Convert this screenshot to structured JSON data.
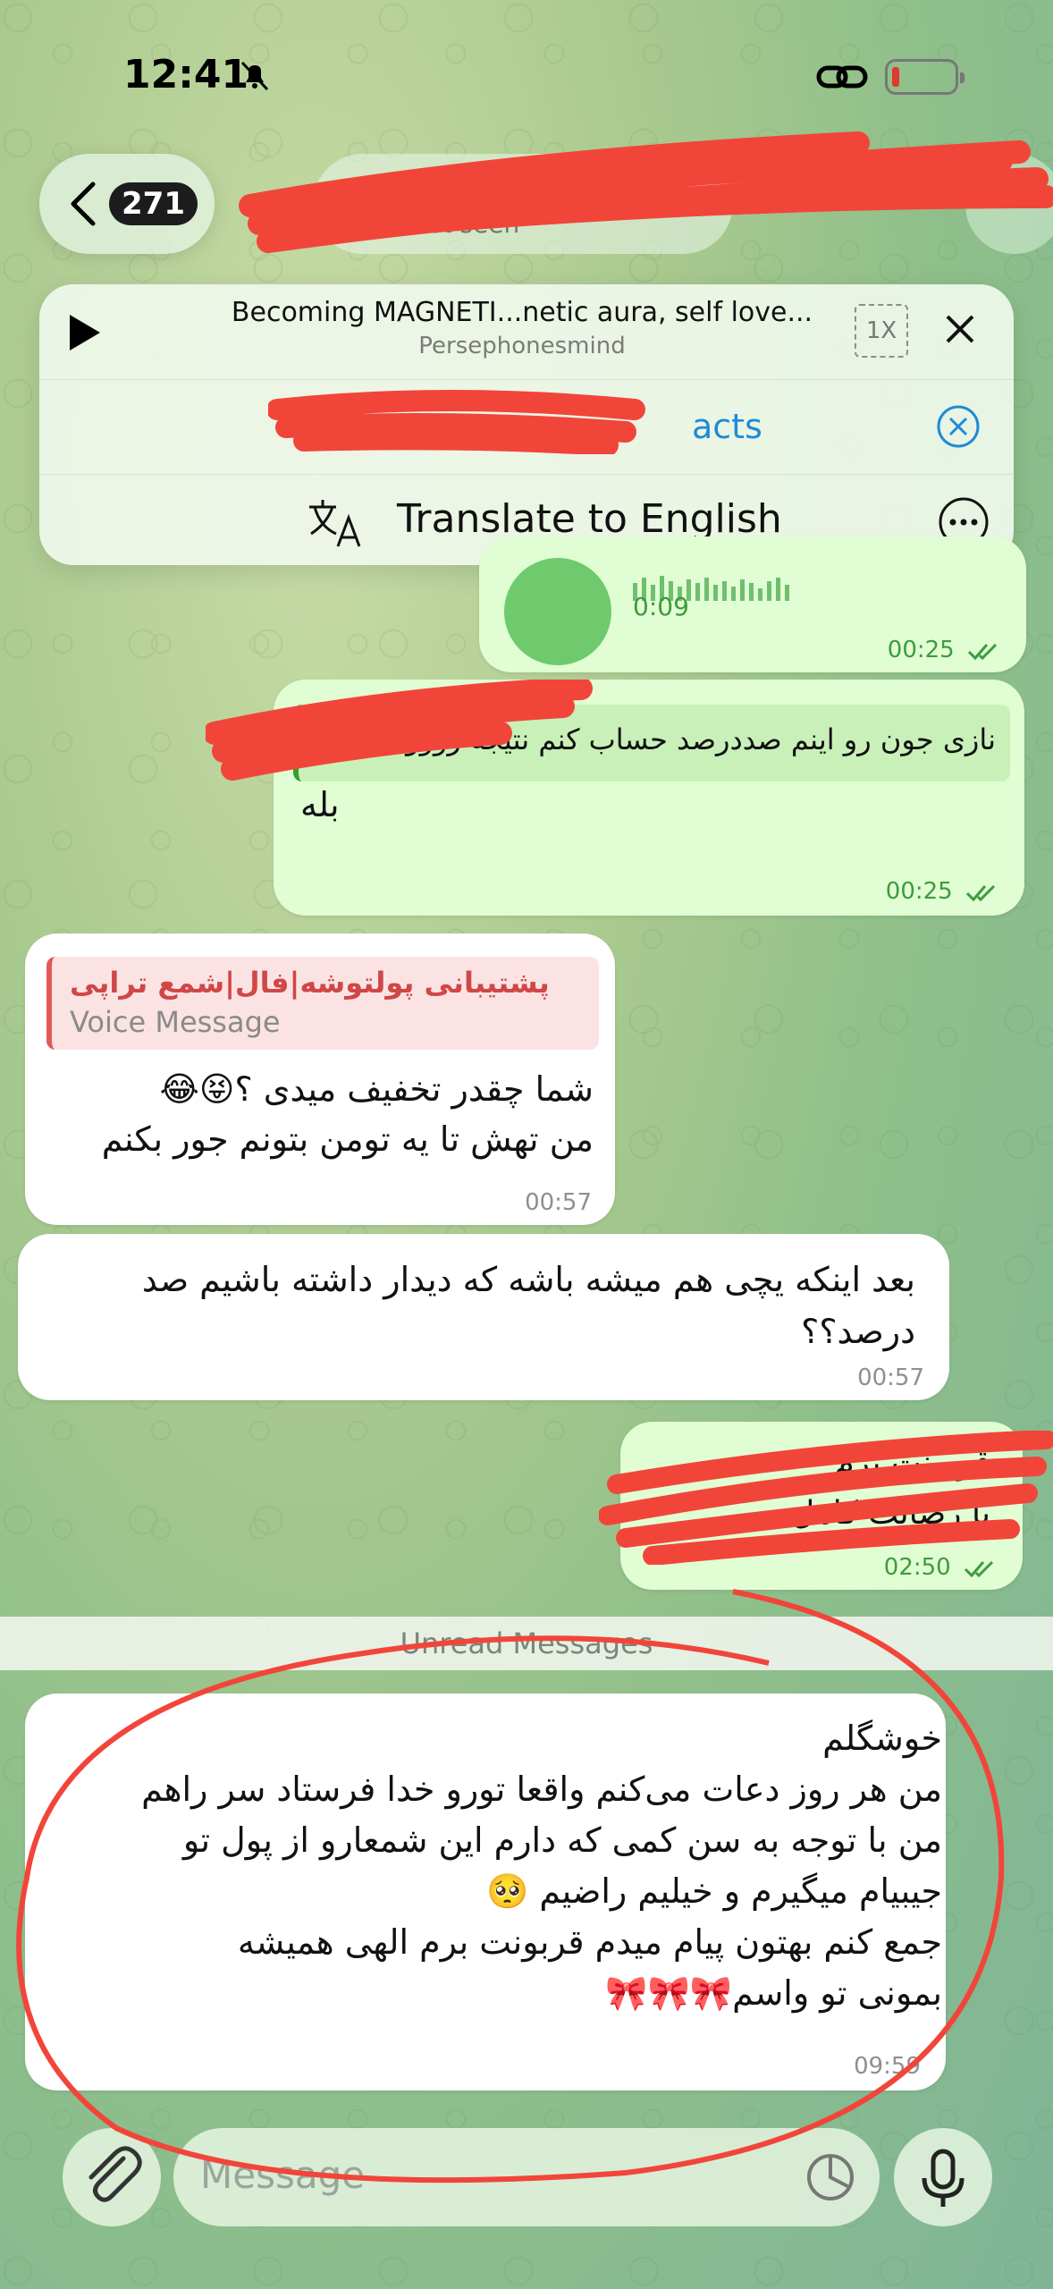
{
  "status_bar": {
    "time": "12:41"
  },
  "header": {
    "back_count": "271",
    "subtitle": "last seen"
  },
  "player": {
    "title": "Becoming MAGNETI...netic aura, self love...",
    "artist": "Persephonesmind",
    "speed": "1X"
  },
  "pinned": {
    "text": "acts"
  },
  "translate": {
    "label": "Translate to English"
  },
  "messages": {
    "voice": {
      "duration": "0:09",
      "time": "00:25"
    },
    "reply": {
      "quote": "نازی جون رو اینم صددرصد حساب کنم نتیجه رووو؟",
      "body": "بله",
      "time": "00:25"
    },
    "in1": {
      "quote_name": "پشتیبانی پولتوشه|فال|شمع تراپی",
      "quote_sub": "Voice Message",
      "lines": [
        "شما چقدر تخفیف میدی ؟😝😂",
        "من تهش تا یه تومن بتونم جور بکنم"
      ],
      "time": "00:57"
    },
    "in2": {
      "text": "بعد اینکه یچی هم میشه باشه که دیدار داشته باشیم صد درصد؟؟",
      "time": "00:57"
    },
    "out3": {
      "line1": "قربونت برم",
      "line2": "با رضایت کامل",
      "time": "02:50"
    },
    "unread_label": "Unread Messages",
    "in4": {
      "lines": [
        "خوشگلم",
        "من هر روز دعات می‌کنم واقعا تورو خدا فرستاد سر راهم",
        "من با توجه به سن کمی که دارم این شمعارو از پول تو",
        "جیبیام میگیرم و خیلیم راضیم 🥺",
        "جمع کنم بهتون پیام میدم قربونت برم الهی همیشه",
        "بمونی تو واسم🎀🎀🎀"
      ],
      "time": "09:59"
    }
  },
  "composer": {
    "placeholder": "Message"
  },
  "colors": {
    "outgoing_bubble": "#e1fdd3",
    "incoming_bubble": "#ffffff",
    "accent_green": "#3e9b3e",
    "link_blue": "#1e8bd6",
    "redaction_red": "#f2453a"
  }
}
